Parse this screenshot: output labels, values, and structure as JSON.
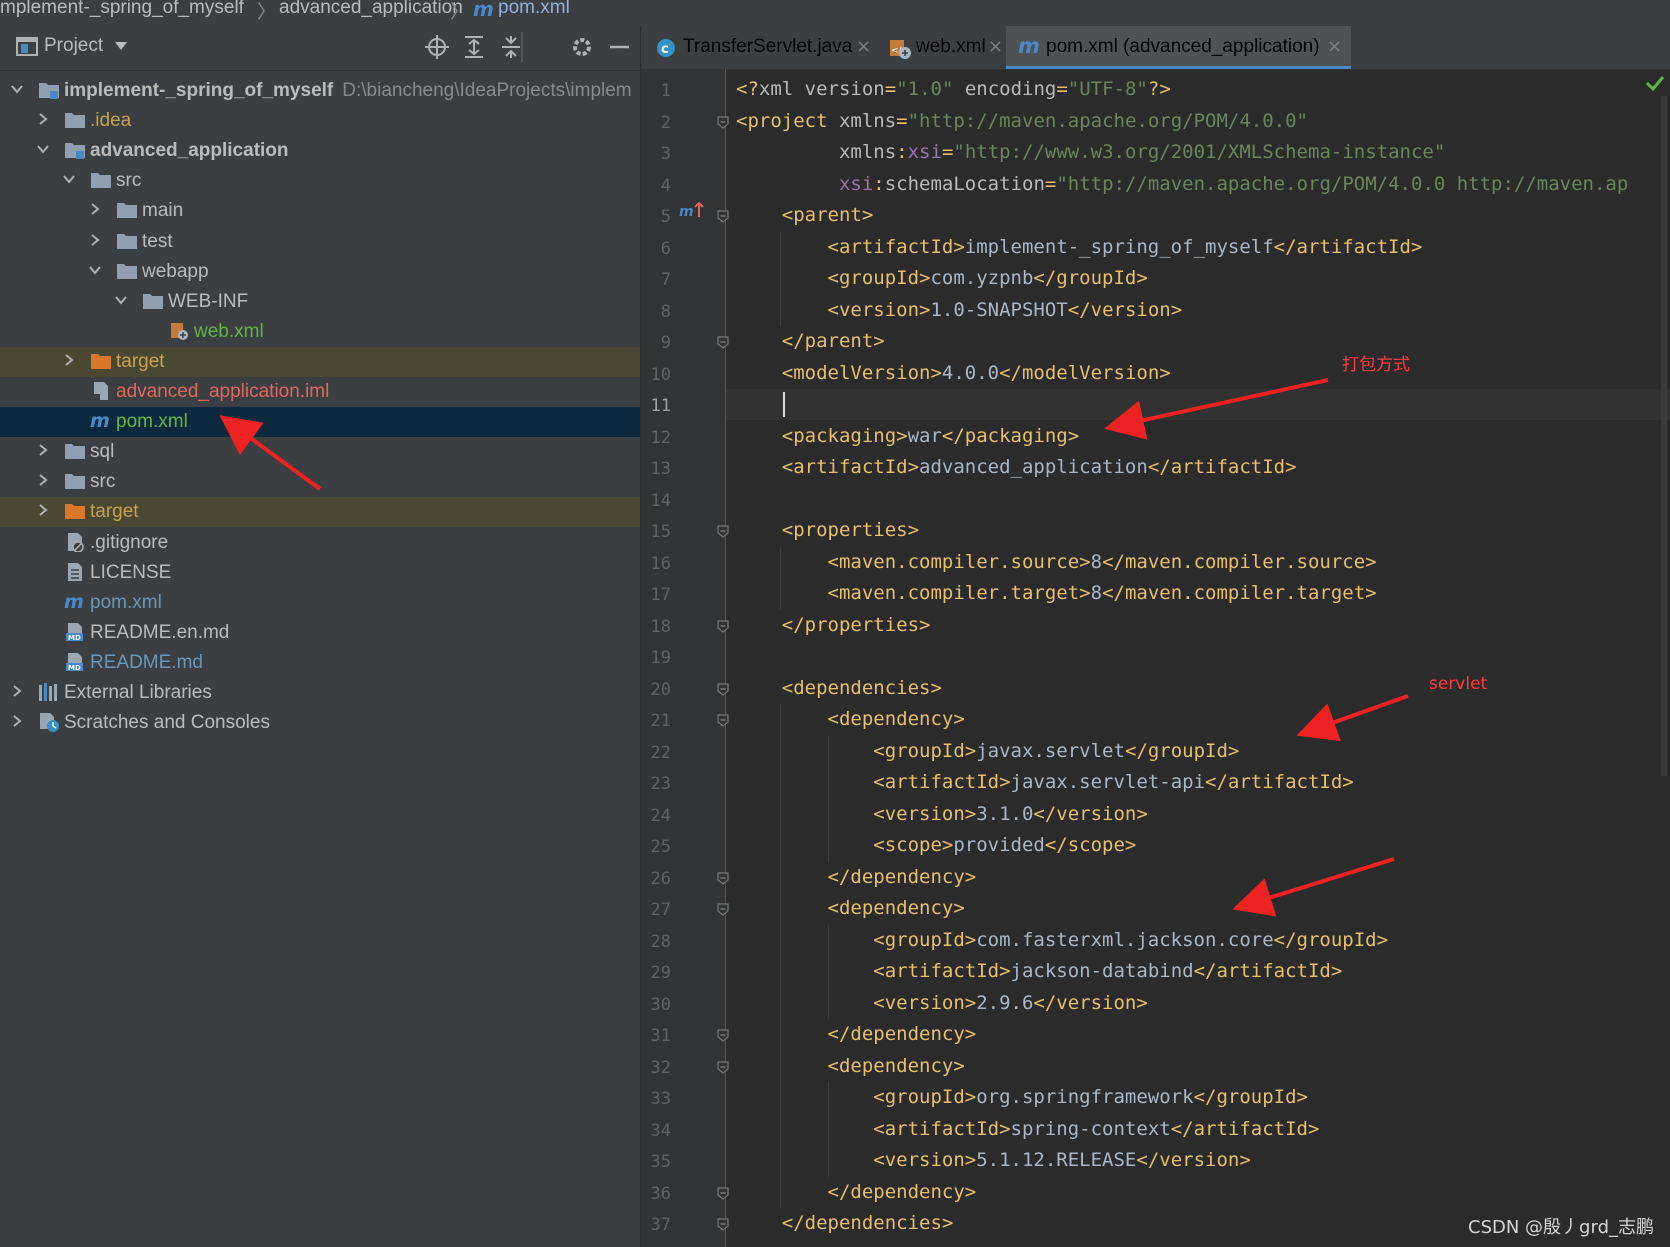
{
  "breadcrumb": [
    "mplement-_spring_of_myself",
    "advanced_application",
    "pom.xml"
  ],
  "project_panel": {
    "title": "Project",
    "tree": [
      {
        "label": "implement-_spring_of_myself",
        "path": "D:\\biancheng\\IdeaProjects\\implem",
        "color": "#bbbbbb",
        "bold": true,
        "depth": 0,
        "expander": "open",
        "icon": "module-folder-icon"
      },
      {
        "label": ".idea",
        "color": "#c7a34e",
        "depth": 1,
        "expander": "closed",
        "icon": "folder-icon"
      },
      {
        "label": "advanced_application",
        "color": "#bbbbbb",
        "bold": true,
        "depth": 1,
        "expander": "open",
        "icon": "module-folder-icon"
      },
      {
        "label": "src",
        "color": "#bbbbbb",
        "depth": 2,
        "expander": "open",
        "icon": "folder-icon"
      },
      {
        "label": "main",
        "color": "#bbbbbb",
        "depth": 3,
        "expander": "closed",
        "icon": "folder-icon"
      },
      {
        "label": "test",
        "color": "#bbbbbb",
        "depth": 3,
        "expander": "closed",
        "icon": "folder-icon"
      },
      {
        "label": "webapp",
        "color": "#bbbbbb",
        "depth": 3,
        "expander": "open",
        "icon": "folder-icon"
      },
      {
        "label": "WEB-INF",
        "color": "#bbbbbb",
        "depth": 4,
        "expander": "open",
        "icon": "folder-icon"
      },
      {
        "label": "web.xml",
        "color": "#62b543",
        "depth": 5,
        "expander": "none",
        "icon": "web-xml-icon"
      },
      {
        "label": "target",
        "color": "#c7a34e",
        "depth": 2,
        "expander": "closed",
        "icon": "excluded-folder-icon",
        "highlight": "target"
      },
      {
        "label": "advanced_application.iml",
        "color": "#e0685a",
        "depth": 2,
        "expander": "none",
        "icon": "iml-file-icon"
      },
      {
        "label": "pom.xml",
        "color": "#62b543",
        "depth": 2,
        "expander": "none",
        "icon": "maven-icon",
        "highlight": "selected"
      },
      {
        "label": "sql",
        "color": "#bbbbbb",
        "depth": 1,
        "expander": "closed",
        "icon": "folder-icon"
      },
      {
        "label": "src",
        "color": "#bbbbbb",
        "depth": 1,
        "expander": "closed",
        "icon": "folder-icon"
      },
      {
        "label": "target",
        "color": "#c7a34e",
        "depth": 1,
        "expander": "closed",
        "icon": "excluded-folder-icon",
        "highlight": "target"
      },
      {
        "label": ".gitignore",
        "color": "#bbbbbb",
        "depth": 1,
        "expander": "none",
        "icon": "gitignore-file-icon"
      },
      {
        "label": "LICENSE",
        "color": "#bbbbbb",
        "depth": 1,
        "expander": "none",
        "icon": "text-file-icon"
      },
      {
        "label": "pom.xml",
        "color": "#6897bb",
        "depth": 1,
        "expander": "none",
        "icon": "maven-icon"
      },
      {
        "label": "README.en.md",
        "color": "#bbbbbb",
        "depth": 1,
        "expander": "none",
        "icon": "markdown-file-icon"
      },
      {
        "label": "README.md",
        "color": "#6897bb",
        "depth": 1,
        "expander": "none",
        "icon": "markdown-file-icon"
      },
      {
        "label": "External Libraries",
        "color": "#bbbbbb",
        "depth": 0,
        "expander": "closed",
        "icon": "libraries-icon"
      },
      {
        "label": "Scratches and Consoles",
        "color": "#bbbbbb",
        "depth": 0,
        "expander": "closed",
        "icon": "scratches-icon"
      }
    ]
  },
  "tabs": [
    {
      "label": "TransferServlet.java",
      "color": "#62b543",
      "icon": "java-class-icon"
    },
    {
      "label": "web.xml",
      "color": "#62b543",
      "icon": "web-xml-icon"
    },
    {
      "label": "pom.xml (advanced_application)",
      "color": "#62b543",
      "icon": "maven-icon",
      "active": true
    }
  ],
  "editor": {
    "current_line": 11,
    "lines": [
      [
        [
          "t",
          "<?"
        ],
        [
          "a",
          "xml version"
        ],
        [
          "t",
          "="
        ],
        [
          "s",
          "\"1.0\""
        ],
        [
          "a",
          " encoding"
        ],
        [
          "t",
          "="
        ],
        [
          "s",
          "\"UTF-8\""
        ],
        [
          "t",
          "?>"
        ]
      ],
      [
        [
          "t",
          "<project"
        ],
        [
          "a",
          " xmlns"
        ],
        [
          "t",
          "="
        ],
        [
          "s",
          "\"http://maven.apache.org/POM/4.0.0\""
        ]
      ],
      [
        [
          "a",
          "         xmlns"
        ],
        [
          "t",
          ":"
        ],
        [
          "n",
          "xsi"
        ],
        [
          "t",
          "="
        ],
        [
          "s",
          "\"http://www.w3.org/2001/XMLSchema-instance\""
        ]
      ],
      [
        [
          "a",
          "         "
        ],
        [
          "n",
          "xsi"
        ],
        [
          "t",
          ":"
        ],
        [
          "a",
          "schemaLocation"
        ],
        [
          "t",
          "="
        ],
        [
          "s",
          "\"http://maven.apache.org/POM/4.0.0 http://maven.ap"
        ]
      ],
      [
        [
          "t",
          "    <parent>"
        ]
      ],
      [
        [
          "t",
          "        <artifactId>"
        ],
        [
          "x",
          "implement-_spring_of_myself"
        ],
        [
          "t",
          "</artifactId>"
        ]
      ],
      [
        [
          "t",
          "        <groupId>"
        ],
        [
          "x",
          "com.yzpnb"
        ],
        [
          "t",
          "</groupId>"
        ]
      ],
      [
        [
          "t",
          "        <version>"
        ],
        [
          "x",
          "1.0-SNAPSHOT"
        ],
        [
          "t",
          "</version>"
        ]
      ],
      [
        [
          "t",
          "    </parent>"
        ]
      ],
      [
        [
          "t",
          "    <modelVersion>"
        ],
        [
          "x",
          "4.0.0"
        ],
        [
          "t",
          "</modelVersion>"
        ]
      ],
      [],
      [
        [
          "t",
          "    <packaging>"
        ],
        [
          "x",
          "war"
        ],
        [
          "t",
          "</packaging>"
        ]
      ],
      [
        [
          "t",
          "    <artifactId>"
        ],
        [
          "x",
          "advanced_application"
        ],
        [
          "t",
          "</artifactId>"
        ]
      ],
      [],
      [
        [
          "t",
          "    <properties>"
        ]
      ],
      [
        [
          "t",
          "        <maven.compiler.source>"
        ],
        [
          "x",
          "8"
        ],
        [
          "t",
          "</maven.compiler.source>"
        ]
      ],
      [
        [
          "t",
          "        <maven.compiler.target>"
        ],
        [
          "x",
          "8"
        ],
        [
          "t",
          "</maven.compiler.target>"
        ]
      ],
      [
        [
          "t",
          "    </properties>"
        ]
      ],
      [],
      [
        [
          "t",
          "    <dependencies>"
        ]
      ],
      [
        [
          "t",
          "        <dependency>"
        ]
      ],
      [
        [
          "t",
          "            <groupId>"
        ],
        [
          "x",
          "javax.servlet"
        ],
        [
          "t",
          "</groupId>"
        ]
      ],
      [
        [
          "t",
          "            <artifactId>"
        ],
        [
          "x",
          "javax.servlet-api"
        ],
        [
          "t",
          "</artifactId>"
        ]
      ],
      [
        [
          "t",
          "            <version>"
        ],
        [
          "x",
          "3.1.0"
        ],
        [
          "t",
          "</version>"
        ]
      ],
      [
        [
          "t",
          "            <scope>"
        ],
        [
          "x",
          "provided"
        ],
        [
          "t",
          "</scope>"
        ]
      ],
      [
        [
          "t",
          "        </dependency>"
        ]
      ],
      [
        [
          "t",
          "        <dependency>"
        ]
      ],
      [
        [
          "t",
          "            <groupId>"
        ],
        [
          "x",
          "com.fasterxml.jackson.core"
        ],
        [
          "t",
          "</groupId>"
        ]
      ],
      [
        [
          "t",
          "            <artifactId>"
        ],
        [
          "x",
          "jackson-databind"
        ],
        [
          "t",
          "</artifactId>"
        ]
      ],
      [
        [
          "t",
          "            <version>"
        ],
        [
          "x",
          "2.9.6"
        ],
        [
          "t",
          "</version>"
        ]
      ],
      [
        [
          "t",
          "        </dependency>"
        ]
      ],
      [
        [
          "t",
          "        <dependency>"
        ]
      ],
      [
        [
          "t",
          "            <groupId>"
        ],
        [
          "x",
          "org.springframework"
        ],
        [
          "t",
          "</groupId>"
        ]
      ],
      [
        [
          "t",
          "            <artifactId>"
        ],
        [
          "x",
          "spring-context"
        ],
        [
          "t",
          "</artifactId>"
        ]
      ],
      [
        [
          "t",
          "            <version>"
        ],
        [
          "x",
          "5.1.12.RELEASE"
        ],
        [
          "t",
          "</version>"
        ]
      ],
      [
        [
          "t",
          "        </dependency>"
        ]
      ],
      [
        [
          "t",
          "    </dependencies>"
        ]
      ]
    ],
    "fold_lines": [
      2,
      5,
      9,
      15,
      18,
      20,
      21,
      26,
      27,
      31,
      32,
      36,
      37
    ]
  },
  "annotations": {
    "packaging_note": "打包方式",
    "servlet_note": "servlet"
  },
  "watermark": "CSDN @殷丿grd_志鹏"
}
